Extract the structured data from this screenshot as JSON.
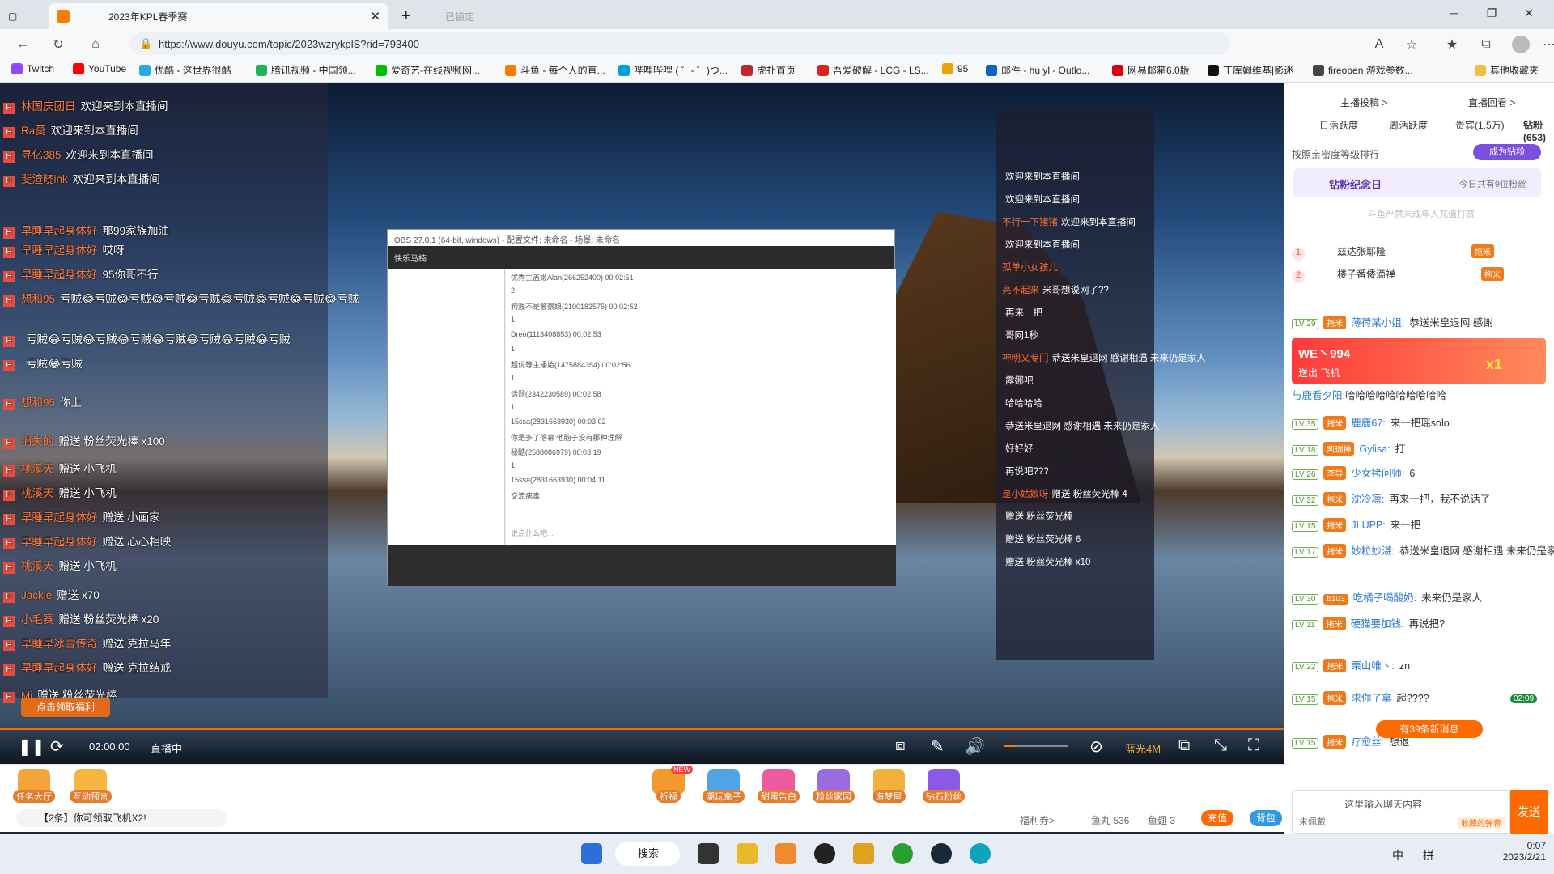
{
  "browser": {
    "tabs": [
      {
        "label": "2023年KPL春季赛"
      }
    ],
    "tab_locked": "已锁定",
    "url": "https://www.douyu.com/topic/2023wzrykplS?rid=793400",
    "bookmarks": [
      "Twitch",
      "YouTube",
      "优酷 - 这世界很酷",
      "腾讯视频 - 中国领...",
      "爱奇艺-在线视频网...",
      "斗鱼 - 每个人的直...",
      "哔哩哔哩 ( ゜- ゜)つ...",
      "虎扑首页",
      "吾爱破解 - LCG - LS...",
      "95",
      "邮件 - hu yl - Outlo...",
      "网易邮箱6.0版",
      "丁库姆维基|影迷",
      "fireopen 游戏参数...",
      "其他收藏夹"
    ]
  },
  "left_chat": [
    {
      "user": "林国庆团日",
      "text": "欢迎来到本直播间"
    },
    {
      "user": "Ra莫",
      "text": "欢迎来到本直播间"
    },
    {
      "user": "寻亿385",
      "text": "欢迎来到本直播间"
    },
    {
      "user": "斐渣晓ink",
      "text": "欢迎来到本直播间"
    },
    {
      "user": "早睡早起身体好",
      "text": "那99家族加油"
    },
    {
      "user": "早睡早起身体好",
      "text": "哎呀"
    },
    {
      "user": "早睡早起身体好",
      "text": "95你哥不行"
    },
    {
      "user": "想和95",
      "text": "亏贼😂亏贼😂亏贼😂亏贼😂亏贼😂亏贼😂亏贼😂亏贼😂亏贼"
    },
    {
      "user": "",
      "text": "亏贼😂亏贼😂亏贼😂亏贼😂亏贼😂亏贼😂亏贼😂亏贼"
    },
    {
      "user": "",
      "text": "亏贼😂亏贼"
    },
    {
      "user": "想和95",
      "text": "你上"
    },
    {
      "user": "消失的",
      "text": "赠送 粉丝荧光棒 x100"
    },
    {
      "user": "桃溪天",
      "text": "赠送 小飞机"
    },
    {
      "user": "桃溪天",
      "text": "赠送 小飞机"
    },
    {
      "user": "早睡早起身体好",
      "text": "赠送 小画家"
    },
    {
      "user": "早睡早起身体好",
      "text": "赠送 心心相映"
    },
    {
      "user": "桃溪天",
      "text": "赠送 小飞机"
    },
    {
      "user": "Jackie",
      "text": "赠送 x70"
    },
    {
      "user": "小毛赛",
      "text": "赠送 粉丝荧光棒 x20"
    },
    {
      "user": "早睡早冰雪传奇",
      "text": "赠送 克拉马年"
    },
    {
      "user": "早睡早起身体好",
      "text": "赠送 克拉结戒"
    },
    {
      "user": "Mi",
      "text": "赠送 粉丝荧光棒"
    }
  ],
  "left_claim_button": "点击领取福利",
  "obs": {
    "title": "OBS 27.0.1 (64-bit, windows) - 配置文件: 未命名 - 场景: 未命名",
    "channel": "快乐马楠",
    "messages": [
      "优秀主盖姬Alan(266252400)  00:02:51",
      "2",
      "狗贱不是警察娘(2100182575)  00:02:52",
      "1",
      "Dreo(1113408853)  00:02:53",
      "1",
      "超优等主播始(1475884354) 00:02:56",
      "1",
      "话题(2342230589)  00:02:58",
      "1",
      "15ssa(2831663930)  00:03:02",
      "你是多了落幕 他脑子没有那种理解",
      "秘酷(2588086979)  00:03:19",
      "1",
      "15ssa(2831663930)  00:04:11",
      "交流病毒"
    ],
    "input_placeholder": "说点什么吧..."
  },
  "video_overlay_chat": [
    {
      "user": "",
      "text": "欢迎来到本直播间"
    },
    {
      "user": "",
      "text": "欢迎来到本直播间"
    },
    {
      "user": "不行一下猪猪",
      "text": "欢迎来到本直播间"
    },
    {
      "user": "",
      "text": "欢迎来到本直播间"
    },
    {
      "user": "孤单小女孩儿",
      "text": ""
    },
    {
      "user": "亮不起来",
      "text": "米哥想说网了??"
    },
    {
      "user": "",
      "text": "再来一把"
    },
    {
      "user": "",
      "text": "哥网1秒"
    },
    {
      "user": "神明又专门",
      "text": "恭送米皇退网 感谢相遇 未来仍是家人"
    },
    {
      "user": "",
      "text": "露娜吧"
    },
    {
      "user": "",
      "text": "哈哈哈哈"
    },
    {
      "user": "",
      "text": "恭送米皇退网 感谢相遇 未来仍是家人"
    },
    {
      "user": "",
      "text": "好好好"
    },
    {
      "user": "",
      "text": "再说吧???"
    },
    {
      "user": "是小姑娘呀",
      "text": "赠送 粉丝荧光棒 4"
    },
    {
      "user": "",
      "text": "赠送 粉丝荧光棒"
    },
    {
      "user": "",
      "text": "赠送 粉丝荧光棒 6"
    },
    {
      "user": "",
      "text": "赠送 粉丝荧光棒 x10"
    }
  ],
  "player": {
    "time": "02:00:00",
    "status": "直播中",
    "quality": "蓝光4M"
  },
  "gifts_left": [
    {
      "label": "任务大厅"
    },
    {
      "label": "互动预言"
    }
  ],
  "notice": "【2条】你可领取飞机X2!",
  "gifts": [
    {
      "label": "祈福",
      "tag": "NEW"
    },
    {
      "label": "潮玩盒子"
    },
    {
      "label": "甜蜜告白"
    },
    {
      "label": "粉丝家园"
    },
    {
      "label": "造梦屋"
    },
    {
      "label": "钻石粉丝"
    }
  ],
  "bottom_stats": {
    "welfare": "福利券>",
    "fish_ball": "鱼丸 536",
    "fish_fin": "鱼翅 3",
    "recharge": "充值",
    "bag": "背包"
  },
  "sidebar": {
    "top_links": [
      "主播投稿 >",
      "直播回看 >"
    ],
    "tabs": [
      "日活跃度",
      "周活跃度",
      "贵宾(1.5万)",
      "钻粉(653)"
    ],
    "sort_label": "按照亲密度等级排行",
    "become_button": "成为钻粉",
    "anniversary": {
      "title": "钻粉纪念日",
      "count": "今日共有9位粉丝"
    },
    "notice": "斗鱼严禁未成年人充值打赏",
    "ranks": [
      {
        "rank": "1",
        "name": "兹达张耶隆",
        "badge": "拖米"
      },
      {
        "rank": "2",
        "name": "楼子番倭滴禅",
        "badge": "拖米"
      }
    ],
    "banner": {
      "title": "WE丶994",
      "sub": "送出 飞机",
      "multiplier": "x1"
    },
    "banner_msg": {
      "user": "与鹿看夕阳:",
      "text": "哈哈哈哈哈哈哈哈哈哈"
    },
    "messages": [
      {
        "lv": "LV 29",
        "badge": "拖米",
        "user": "薄荷某小姐:",
        "text": "恭送米皇退网 感谢"
      },
      {
        "lv": "LV 35",
        "badge": "拖米",
        "user": "鹿鹿67:",
        "text": "来一把瑶solo"
      },
      {
        "lv": "LV 18",
        "badge": "凯瑞神",
        "user": "Gylisa:",
        "text": "打"
      },
      {
        "lv": "LV 26",
        "badge": "李导",
        "user": "少女拷问师:",
        "text": "6"
      },
      {
        "lv": "LV 32",
        "badge": "拖米",
        "user": "沈冷凛:",
        "text": "再来一把，我不说话了"
      },
      {
        "lv": "LV 15",
        "badge": "拖米",
        "user": "JLUPP:",
        "text": "来一把"
      },
      {
        "lv": "LV 17",
        "badge": "拖米",
        "user": "妙粒妙湛:",
        "text": "恭送米皇退网 感谢相遇 未来仍是家人"
      },
      {
        "lv": "LV 30",
        "badge": "b1u3",
        "user": "吃橘子喝酸奶:",
        "text": "未来仍是家人"
      },
      {
        "lv": "LV 11",
        "badge": "拖米",
        "user": "硬猫要加钱:",
        "text": "再说把?"
      },
      {
        "lv": "LV 22",
        "badge": "拖米",
        "user": "栗山唯丶:",
        "text": "zn"
      },
      {
        "lv": "LV 15",
        "badge": "拖米",
        "user": "求你了拿",
        "text": "超????"
      },
      {
        "lv": "LV 15",
        "badge": "拖米",
        "user": "疗愈丝:",
        "text": "想退"
      }
    ],
    "new_messages": "有39条新消息",
    "chest_timer": "02:09",
    "input_placeholder": "这里输入聊天内容",
    "input_badge": "收藏的弹幕",
    "send_button": "发送",
    "unworn": "未佩戴"
  },
  "taskbar": {
    "search": "搜索",
    "ime": "中",
    "ime2": "拼",
    "time": "0:07",
    "date": "2023/2/21"
  }
}
